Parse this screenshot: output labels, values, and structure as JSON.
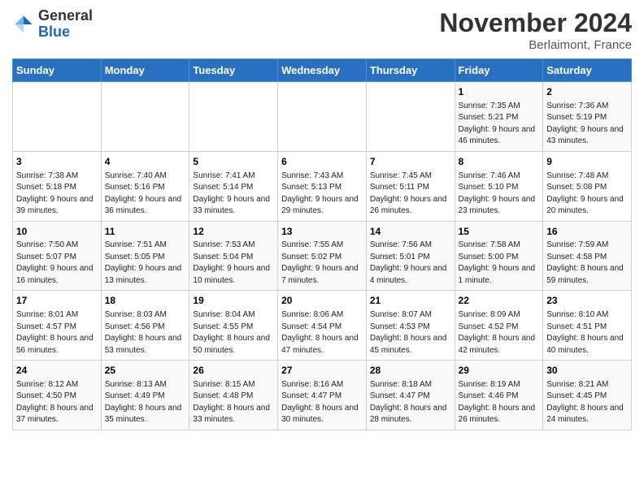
{
  "logo": {
    "general": "General",
    "blue": "Blue"
  },
  "title": "November 2024",
  "location": "Berlaimont, France",
  "days_of_week": [
    "Sunday",
    "Monday",
    "Tuesday",
    "Wednesday",
    "Thursday",
    "Friday",
    "Saturday"
  ],
  "weeks": [
    [
      {
        "day": "",
        "info": ""
      },
      {
        "day": "",
        "info": ""
      },
      {
        "day": "",
        "info": ""
      },
      {
        "day": "",
        "info": ""
      },
      {
        "day": "",
        "info": ""
      },
      {
        "day": "1",
        "info": "Sunrise: 7:35 AM\nSunset: 5:21 PM\nDaylight: 9 hours and 46 minutes."
      },
      {
        "day": "2",
        "info": "Sunrise: 7:36 AM\nSunset: 5:19 PM\nDaylight: 9 hours and 43 minutes."
      }
    ],
    [
      {
        "day": "3",
        "info": "Sunrise: 7:38 AM\nSunset: 5:18 PM\nDaylight: 9 hours and 39 minutes."
      },
      {
        "day": "4",
        "info": "Sunrise: 7:40 AM\nSunset: 5:16 PM\nDaylight: 9 hours and 36 minutes."
      },
      {
        "day": "5",
        "info": "Sunrise: 7:41 AM\nSunset: 5:14 PM\nDaylight: 9 hours and 33 minutes."
      },
      {
        "day": "6",
        "info": "Sunrise: 7:43 AM\nSunset: 5:13 PM\nDaylight: 9 hours and 29 minutes."
      },
      {
        "day": "7",
        "info": "Sunrise: 7:45 AM\nSunset: 5:11 PM\nDaylight: 9 hours and 26 minutes."
      },
      {
        "day": "8",
        "info": "Sunrise: 7:46 AM\nSunset: 5:10 PM\nDaylight: 9 hours and 23 minutes."
      },
      {
        "day": "9",
        "info": "Sunrise: 7:48 AM\nSunset: 5:08 PM\nDaylight: 9 hours and 20 minutes."
      }
    ],
    [
      {
        "day": "10",
        "info": "Sunrise: 7:50 AM\nSunset: 5:07 PM\nDaylight: 9 hours and 16 minutes."
      },
      {
        "day": "11",
        "info": "Sunrise: 7:51 AM\nSunset: 5:05 PM\nDaylight: 9 hours and 13 minutes."
      },
      {
        "day": "12",
        "info": "Sunrise: 7:53 AM\nSunset: 5:04 PM\nDaylight: 9 hours and 10 minutes."
      },
      {
        "day": "13",
        "info": "Sunrise: 7:55 AM\nSunset: 5:02 PM\nDaylight: 9 hours and 7 minutes."
      },
      {
        "day": "14",
        "info": "Sunrise: 7:56 AM\nSunset: 5:01 PM\nDaylight: 9 hours and 4 minutes."
      },
      {
        "day": "15",
        "info": "Sunrise: 7:58 AM\nSunset: 5:00 PM\nDaylight: 9 hours and 1 minute."
      },
      {
        "day": "16",
        "info": "Sunrise: 7:59 AM\nSunset: 4:58 PM\nDaylight: 8 hours and 59 minutes."
      }
    ],
    [
      {
        "day": "17",
        "info": "Sunrise: 8:01 AM\nSunset: 4:57 PM\nDaylight: 8 hours and 56 minutes."
      },
      {
        "day": "18",
        "info": "Sunrise: 8:03 AM\nSunset: 4:56 PM\nDaylight: 8 hours and 53 minutes."
      },
      {
        "day": "19",
        "info": "Sunrise: 8:04 AM\nSunset: 4:55 PM\nDaylight: 8 hours and 50 minutes."
      },
      {
        "day": "20",
        "info": "Sunrise: 8:06 AM\nSunset: 4:54 PM\nDaylight: 8 hours and 47 minutes."
      },
      {
        "day": "21",
        "info": "Sunrise: 8:07 AM\nSunset: 4:53 PM\nDaylight: 8 hours and 45 minutes."
      },
      {
        "day": "22",
        "info": "Sunrise: 8:09 AM\nSunset: 4:52 PM\nDaylight: 8 hours and 42 minutes."
      },
      {
        "day": "23",
        "info": "Sunrise: 8:10 AM\nSunset: 4:51 PM\nDaylight: 8 hours and 40 minutes."
      }
    ],
    [
      {
        "day": "24",
        "info": "Sunrise: 8:12 AM\nSunset: 4:50 PM\nDaylight: 8 hours and 37 minutes."
      },
      {
        "day": "25",
        "info": "Sunrise: 8:13 AM\nSunset: 4:49 PM\nDaylight: 8 hours and 35 minutes."
      },
      {
        "day": "26",
        "info": "Sunrise: 8:15 AM\nSunset: 4:48 PM\nDaylight: 8 hours and 33 minutes."
      },
      {
        "day": "27",
        "info": "Sunrise: 8:16 AM\nSunset: 4:47 PM\nDaylight: 8 hours and 30 minutes."
      },
      {
        "day": "28",
        "info": "Sunrise: 8:18 AM\nSunset: 4:47 PM\nDaylight: 8 hours and 28 minutes."
      },
      {
        "day": "29",
        "info": "Sunrise: 8:19 AM\nSunset: 4:46 PM\nDaylight: 8 hours and 26 minutes."
      },
      {
        "day": "30",
        "info": "Sunrise: 8:21 AM\nSunset: 4:45 PM\nDaylight: 8 hours and 24 minutes."
      }
    ]
  ]
}
